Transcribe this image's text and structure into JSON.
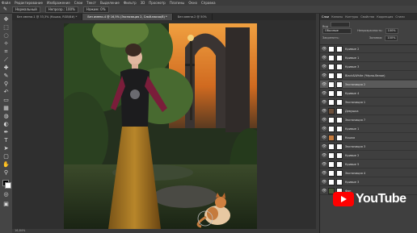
{
  "menu": [
    "Файл",
    "Редактирование",
    "Изображение",
    "Слои",
    "Текст",
    "Выделение",
    "Фильтр",
    "3D",
    "Просмотр",
    "Плагины",
    "Окно",
    "Справка"
  ],
  "options_bar": {
    "mode_label": "Нормальный",
    "opacity_label": "Непрозр.: 100%",
    "flow_label": "Нажим: 0%"
  },
  "tabs": [
    {
      "label": "Без имени-1 @ 33,3% (Кошка, RGB/8#) *",
      "active": false
    },
    {
      "label": "Без имени-4 @ 16,5% (Экспозиция 2, Слой-маска/8) *",
      "active": true
    },
    {
      "label": "Без имени-2 @ 50%",
      "active": false
    }
  ],
  "status": "16,84%",
  "panels": {
    "tabs": [
      "Слои",
      "Каналы",
      "Контуры",
      "Свойства",
      "Коррекция",
      "Стили"
    ],
    "blend_mode": "Обычные",
    "opacity_label": "Непрозрачность:",
    "opacity_value": "100%",
    "lock_label": "Закрепить:",
    "fill_label": "Заливка:",
    "fill_value": "100%",
    "kind_label": "Вид"
  },
  "layers": [
    {
      "name": "Кривые 2",
      "selected": false,
      "thumb": "#ffffff"
    },
    {
      "name": "Кривые 1",
      "selected": false,
      "thumb": "#ffffff"
    },
    {
      "name": "Кривые 3",
      "selected": false,
      "thumb": "#ffffff"
    },
    {
      "name": "Black&White (Чёрно-белое)",
      "selected": false,
      "thumb": "#ffffff"
    },
    {
      "name": "Экспозиция 2",
      "selected": true,
      "thumb": "#ffffff"
    },
    {
      "name": "Кривые 4",
      "selected": false,
      "thumb": "#ffffff"
    },
    {
      "name": "Экспозиция 1",
      "selected": false,
      "thumb": "#ffffff"
    },
    {
      "name": "Девушка",
      "selected": false,
      "thumb": "#6b4f3a"
    },
    {
      "name": "Экспозиция 7",
      "selected": false,
      "thumb": "#ffffff"
    },
    {
      "name": "Кривые 1",
      "selected": false,
      "thumb": "#ffffff"
    },
    {
      "name": "Кошка",
      "selected": false,
      "thumb": "#c57b3d"
    },
    {
      "name": "Экспозиция 3",
      "selected": false,
      "thumb": "#ffffff"
    },
    {
      "name": "Кривые 2",
      "selected": false,
      "thumb": "#ffffff"
    },
    {
      "name": "Кривые 5",
      "selected": false,
      "thumb": "#ffffff"
    },
    {
      "name": "Экспозиция 4",
      "selected": false,
      "thumb": "#ffffff"
    },
    {
      "name": "Кривые 3",
      "selected": false,
      "thumb": "#ffffff"
    },
    {
      "name": "Фон",
      "selected": false,
      "thumb": "#4a5a3a"
    }
  ],
  "youtube": {
    "label": "YouTube",
    "accent": "#ff0000"
  },
  "icons": [
    "move-icon",
    "marquee-icon",
    "lasso-icon",
    "quick-select-icon",
    "crop-icon",
    "eyedropper-icon",
    "healing-icon",
    "brush-icon",
    "stamp-icon",
    "history-brush-icon",
    "eraser-icon",
    "gradient-icon",
    "blur-icon",
    "dodge-icon",
    "pen-icon",
    "type-icon",
    "path-select-icon",
    "shape-icon",
    "hand-icon",
    "zoom-icon"
  ]
}
